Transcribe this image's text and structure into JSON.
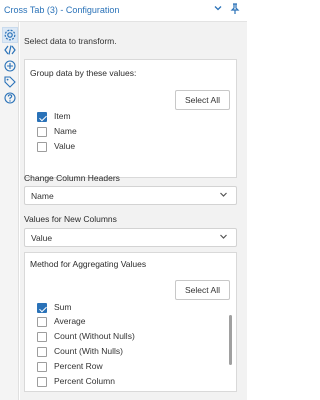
{
  "window": {
    "title": "Cross Tab (3) - Configuration"
  },
  "controls": {
    "collapse_icon": "chevron-down-icon",
    "pin_icon": "pin-icon"
  },
  "rail": {
    "icons": [
      "gear-icon",
      "code-icon",
      "plugin-icon",
      "tag-icon",
      "help-icon"
    ]
  },
  "intro": "Select data to transform.",
  "group": {
    "title": "Group data by these values:",
    "select_all": "Select All",
    "items": [
      {
        "label": "Item",
        "checked": true
      },
      {
        "label": "Name",
        "checked": false
      },
      {
        "label": "Value",
        "checked": false
      }
    ]
  },
  "headers": {
    "label": "Change Column Headers",
    "value": "Name"
  },
  "values": {
    "label": "Values for New Columns",
    "value": "Value"
  },
  "method": {
    "title": "Method for Aggregating Values",
    "select_all": "Select All",
    "items": [
      {
        "label": "Sum",
        "checked": true
      },
      {
        "label": "Average",
        "checked": false
      },
      {
        "label": "Count (Without Nulls)",
        "checked": false
      },
      {
        "label": "Count (With Nulls)",
        "checked": false
      },
      {
        "label": "Percent Row",
        "checked": false
      },
      {
        "label": "Percent Column",
        "checked": false
      }
    ]
  },
  "colors": {
    "accent": "#2a72b8",
    "panel_bg": "#f2f2f2"
  }
}
